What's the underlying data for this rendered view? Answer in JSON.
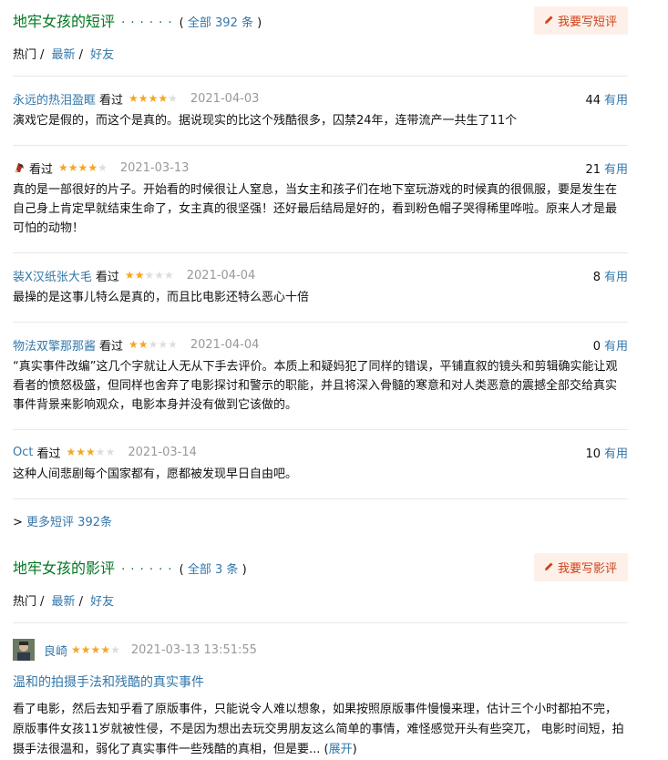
{
  "short_comments": {
    "title": "地牢女孩的短评",
    "dots": "· · · · · ·",
    "count_open": "( ",
    "count_link": "全部 392 条",
    "count_close": " )",
    "write_label": "我要写短评",
    "filters": [
      "热门",
      "最新",
      "好友"
    ],
    "items": [
      {
        "user": "永远的热泪盈眶",
        "status": "看过",
        "stars": 4,
        "date": "2021-04-03",
        "votes": "44",
        "votes_label": "有用",
        "text": "演戏它是假的，而这个是真的。据说现实的比这个残酷很多，囚禁24年，连带流产一共生了11个"
      },
      {
        "user": "",
        "status": "看过",
        "stars": 4,
        "date": "2021-03-13",
        "votes": "21",
        "votes_label": "有用",
        "text": "真的是一部很好的片子。开始看的时候很让人窒息，当女主和孩子们在地下室玩游戏的时候真的很佩服，要是发生在自己身上肯定早就结束生命了，女主真的很坚强！还好最后结局是好的，看到粉色帽子哭得稀里哗啦。原来人才是最可怕的动物！"
      },
      {
        "user": "装X汉纸张大毛",
        "status": "看过",
        "stars": 2,
        "date": "2021-04-04",
        "votes": "8",
        "votes_label": "有用",
        "text": "最操的是这事儿特么是真的，而且比电影还特么恶心十倍"
      },
      {
        "user": "物法双擎那那酱",
        "status": "看过",
        "stars": 2,
        "date": "2021-04-04",
        "votes": "0",
        "votes_label": "有用",
        "text": "“真实事件改编”这几个字就让人无从下手去评价。本质上和疑妈犯了同样的错误，平铺直叙的镜头和剪辑确实能让观看者的愤怒极盛，但同样也舍弃了电影探讨和警示的职能，并且将深入骨髓的寒意和对人类恶意的震撼全部交给真实事件背景来影响观众，电影本身并没有做到它该做的。"
      },
      {
        "user": "Oct",
        "status": "看过",
        "stars": 3,
        "date": "2021-03-14",
        "votes": "10",
        "votes_label": "有用",
        "text": "这种人间悲剧每个国家都有，愿都被发现早日自由吧。"
      }
    ],
    "more_prefix": ">",
    "more_link": "更多短评 392条"
  },
  "reviews": {
    "title": "地牢女孩的影评",
    "dots": "· · · · · ·",
    "count_open": "( ",
    "count_link": "全部 3 条",
    "count_close": " )",
    "write_label": "我要写影评",
    "filters": [
      "热门",
      "最新",
      "好友"
    ],
    "item": {
      "user": "良崎",
      "stars": 4,
      "date": "2021-03-13 13:51:55",
      "title": "温和的拍摄手法和残酷的真实事件",
      "text": "看了电影，然后去知乎看了原版事件，只能说令人难以想象，如果按照原版事件慢慢来理，估计三个小时都拍不完，原版事件女孩11岁就被性侵，不是因为想出去玩交男朋友这么简单的事情，难怪感觉开头有些突兀， 电影时间短，拍摄手法很温和，弱化了真实事件一些残酷的真相，但是要...",
      "expand_open": "(",
      "expand_label": "展开",
      "expand_close": ")"
    }
  },
  "colors": {
    "accent_green": "#007722",
    "link_blue": "#3377aa",
    "star": "#f5a623",
    "button_bg": "#fdf0e8",
    "button_text": "#d0411a"
  }
}
